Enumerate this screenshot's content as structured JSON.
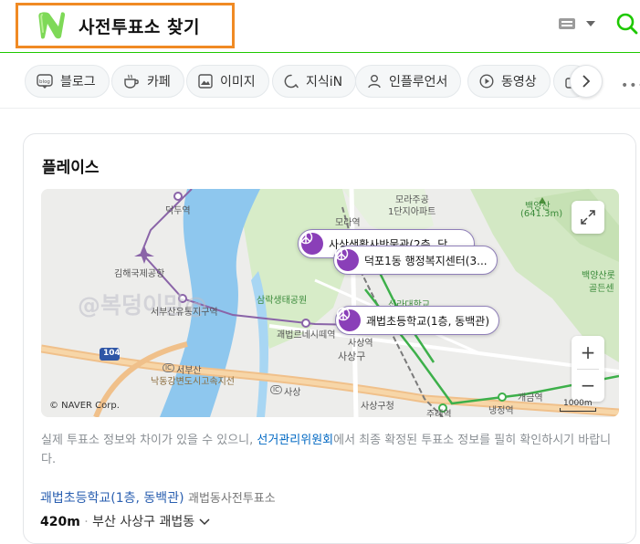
{
  "header": {
    "query": "사전투표소 찾기"
  },
  "tabs": [
    {
      "label": "블로그",
      "icon": "blog-icon"
    },
    {
      "label": "카페",
      "icon": "cafe-icon"
    },
    {
      "label": "이미지",
      "icon": "image-icon"
    },
    {
      "label": "지식iN",
      "icon": "kin-icon"
    },
    {
      "label": "인플루언서",
      "icon": "person-icon"
    },
    {
      "label": "동영상",
      "icon": "play-icon"
    }
  ],
  "card": {
    "title": "플레이스"
  },
  "map": {
    "pins": [
      {
        "label": "사상생활사박물관(2층, 닥"
      },
      {
        "label": "덕포1동 행정복지센터(3..."
      },
      {
        "label": "괘법초등학교(1층, 동백관)"
      }
    ],
    "labels": {
      "deokdu": "덕두역",
      "airport": "김해국제공항",
      "buyu": "서부산유통지구역",
      "samrak": "삼락생태공원",
      "gwaebeop": "괘법르네시떼역",
      "morajugong": "모라주공",
      "apt": "1단지아파트",
      "mora_st": "모라역",
      "silla": "신라대학교",
      "baekyang": "백양산",
      "elev": "(641.3m)",
      "baekyang2": "백양산롯",
      "golden": "골든센",
      "sasang_gu": "사상구",
      "sasang_office": "사상구청",
      "sasang_st": "사상역",
      "seobusan": "서부산",
      "nakdong": "낙동강변도시고속지선",
      "jurye": "주례역",
      "naengjeong": "냉정역",
      "gaegeum": "개금역",
      "ic": "IC",
      "ic2": "IC",
      "sasang_ic": "사상",
      "road104": "104",
      "sasang_dong": "사상역"
    },
    "watermark": "@복덩이맘@",
    "copyright": "© NAVER Corp.",
    "scale": "1000m",
    "zoom_in": "+",
    "zoom_out": "−"
  },
  "notice": {
    "part1": "실제 투표소 정보와 차이가 있을 수 있으니, ",
    "link": "선거관리위원회",
    "part2": "에서 최종 확정된 투표소 정보를 필히 확인하시기 바랍니다."
  },
  "result": {
    "title": "괘법초등학교(1층, 동백관)",
    "subtitle": "괘법동사전투표소",
    "distance": "420m",
    "separator": "·",
    "address": "부산 사상구 괘법동"
  },
  "colors": {
    "naver_green": "#1ec800",
    "highlight_orange": "#f08a24",
    "pin_purple": "#8a3fb8",
    "link_blue": "#2a5fb0"
  }
}
